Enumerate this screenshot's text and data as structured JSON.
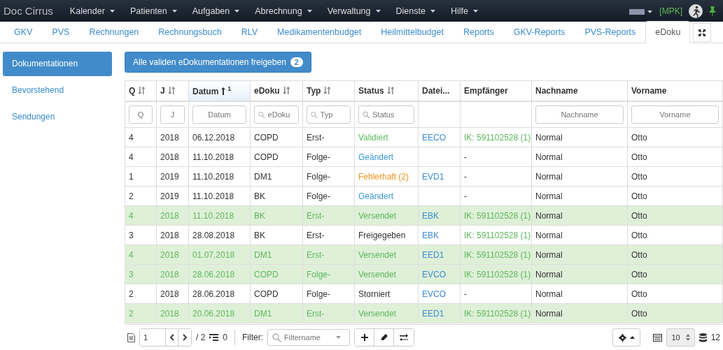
{
  "navbar": {
    "brand": "Doc Cirrus",
    "menus": [
      {
        "label": "Kalender"
      },
      {
        "label": "Patienten"
      },
      {
        "label": "Aufgaben"
      },
      {
        "label": "Abrechnung"
      },
      {
        "label": "Verwaltung"
      },
      {
        "label": "Dienste"
      },
      {
        "label": "Hilfe"
      }
    ],
    "tenant": "[MPK]"
  },
  "tabs": [
    {
      "label": "GKV",
      "selected": false
    },
    {
      "label": "PVS",
      "selected": false
    },
    {
      "label": "Rechnungen",
      "selected": false
    },
    {
      "label": "Rechnungsbuch",
      "selected": false
    },
    {
      "label": "RLV",
      "selected": false
    },
    {
      "label": "Medikamentenbudget",
      "selected": false
    },
    {
      "label": "Heilmittelbudget",
      "selected": false
    },
    {
      "label": "Reports",
      "selected": false
    },
    {
      "label": "GKV-Reports",
      "selected": false
    },
    {
      "label": "PVS-Reports",
      "selected": false
    },
    {
      "label": "eDoku",
      "selected": true
    }
  ],
  "sidebar": {
    "items": [
      {
        "label": "Dokumentationen",
        "selected": true
      },
      {
        "label": "Bevorstehend",
        "selected": false
      },
      {
        "label": "Sendungen",
        "selected": false
      }
    ]
  },
  "action_button": {
    "label": "Alle validen eDokumentationen freigeben",
    "badge": "2"
  },
  "table": {
    "columns": [
      {
        "label": "Q",
        "sortable": true,
        "sorted_ascending": false,
        "filter": {
          "placeholder": "Q",
          "search": false
        }
      },
      {
        "label": "J",
        "sortable": true,
        "sorted_ascending": false,
        "filter": {
          "placeholder": "J",
          "search": false
        }
      },
      {
        "label": "Datum",
        "sortable": true,
        "sorted_ascending": true,
        "sort_order": "1",
        "filter": {
          "placeholder": "Datum",
          "search": false
        }
      },
      {
        "label": "eDoku",
        "sortable": true,
        "sorted_ascending": false,
        "filter": {
          "placeholder": "eDoku",
          "search": true
        }
      },
      {
        "label": "Typ",
        "sortable": true,
        "sorted_ascending": false,
        "filter": {
          "placeholder": "Typ",
          "search": true
        }
      },
      {
        "label": "Status",
        "sortable": true,
        "sorted_ascending": false,
        "filter": {
          "placeholder": "Status",
          "search": true
        }
      },
      {
        "label": "Datei...",
        "sortable": false,
        "sorted_ascending": false
      },
      {
        "label": "Empfänger",
        "sortable": false,
        "sorted_ascending": false
      },
      {
        "label": "Nachname",
        "sortable": false,
        "sorted_ascending": false,
        "filter": {
          "placeholder": "Nachname",
          "search": false
        }
      },
      {
        "label": "Vorname",
        "sortable": false,
        "sorted_ascending": false,
        "filter": {
          "placeholder": "Vorname",
          "search": false
        }
      }
    ],
    "rows": [
      {
        "q": "4",
        "j": "2018",
        "datum": "06.12.2018",
        "edoku": "COPD",
        "typ": "Erst-",
        "status": "Validiert",
        "kind": "valid",
        "datei": "EECO",
        "empfaenger": "IK: 591102528 (1)",
        "nachname": "Normal",
        "vorname": "Otto"
      },
      {
        "q": "4",
        "j": "2018",
        "datum": "11.10.2018",
        "edoku": "COPD",
        "typ": "Folge-",
        "status": "Geändert",
        "kind": "changed",
        "empfaenger": "-",
        "nachname": "Normal",
        "vorname": "Otto"
      },
      {
        "q": "1",
        "j": "2019",
        "datum": "11.10.2018",
        "edoku": "DM1",
        "typ": "Folge-",
        "status": "Fehlerhaft (2)",
        "kind": "error",
        "datei": "EVD1",
        "empfaenger": "-",
        "nachname": "Normal",
        "vorname": "Otto"
      },
      {
        "q": "2",
        "j": "2019",
        "datum": "11.10.2018",
        "edoku": "BK",
        "typ": "Folge-",
        "status": "Geändert",
        "kind": "changed",
        "empfaenger": "-",
        "nachname": "Normal",
        "vorname": "Otto"
      },
      {
        "q": "4",
        "j": "2018",
        "datum": "11.10.2018",
        "edoku": "BK",
        "typ": "Erst-",
        "status": "Versendet",
        "kind": "sent",
        "datei": "EBK",
        "empfaenger": "IK: 591102528 (1)",
        "nachname": "Normal",
        "vorname": "Otto"
      },
      {
        "q": "3",
        "j": "2018",
        "datum": "28.08.2018",
        "edoku": "BK",
        "typ": "Erst-",
        "status": "Freigegeben",
        "kind": "approved",
        "datei": "EBK",
        "empfaenger": "IK: 591102528 (1)",
        "nachname": "Normal",
        "vorname": "Otto"
      },
      {
        "q": "4",
        "j": "2018",
        "datum": "01.07.2018",
        "edoku": "DM1",
        "typ": "Erst-",
        "status": "Versendet",
        "kind": "sent",
        "datei": "EED1",
        "empfaenger": "IK: 591102528 (1)",
        "nachname": "Normal",
        "vorname": "Otto"
      },
      {
        "q": "3",
        "j": "2018",
        "datum": "28.06.2018",
        "edoku": "COPD",
        "typ": "Folge-",
        "status": "Versendet",
        "kind": "sent",
        "datei": "EVCO",
        "empfaenger": "IK: 591102528 (1)",
        "nachname": "Normal",
        "vorname": "Otto"
      },
      {
        "q": "2",
        "j": "2018",
        "datum": "28.06.2018",
        "edoku": "COPD",
        "typ": "Folge-",
        "status": "Storniert",
        "kind": "cancelled",
        "datei": "EVCO",
        "empfaenger": "-",
        "nachname": "Normal",
        "vorname": "Otto"
      },
      {
        "q": "2",
        "j": "2018",
        "datum": "20.06.2018",
        "edoku": "DM1",
        "typ": "Erst-",
        "status": "Versendet",
        "kind": "sent",
        "datei": "EED1",
        "empfaenger": "IK: 591102528 (1)",
        "nachname": "Normal",
        "vorname": "Otto"
      }
    ]
  },
  "footer": {
    "page": "1",
    "pages": "/ 2",
    "selected_count": "0",
    "filter_label": "Filter:",
    "filter_placeholder": "Filtername",
    "page_size": "10",
    "total": "12"
  }
}
